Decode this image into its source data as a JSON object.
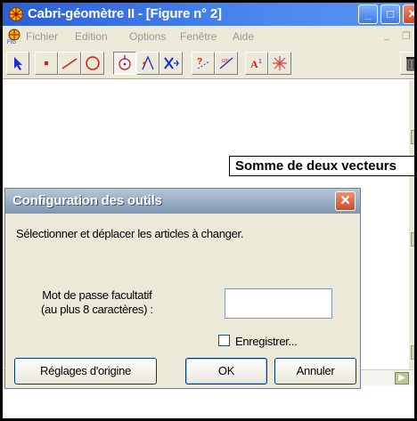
{
  "window": {
    "title": "Cabri-géomètre II - [Figure n° 2]"
  },
  "menu": {
    "items": [
      "Fichier",
      "Edition",
      "Options",
      "Fenêtre",
      "Aide"
    ],
    "mdi_minimize": "_",
    "mdi_restore": "❐"
  },
  "toolbar": {
    "tools": [
      "pointer-tool",
      "point-tool",
      "line-tool",
      "circle-tool",
      "construct-tool",
      "transform-tool",
      "macro-tool",
      "check-property-tool",
      "measure-tool",
      "display-tool",
      "draw-tool",
      "delete-tool"
    ]
  },
  "canvas": {
    "figure_label": "Somme de deux vecteurs"
  },
  "dialog": {
    "title": "Configuration des outils",
    "instruction": "Sélectionner et déplacer les articles à changer.",
    "password_label_line1": "Mot de passe facultatif",
    "password_label_line2": "(au plus 8 caractères) :",
    "password_value": "",
    "save_checkbox_label": "Enregistrer...",
    "save_checked": false,
    "reset_button": "Réglages d'origine",
    "ok_button": "OK",
    "cancel_button": "Annuler"
  },
  "colors": {
    "title_bar": "#2a5fd8",
    "dialog_title": "#7d96b0",
    "close_button": "#d2471f"
  }
}
